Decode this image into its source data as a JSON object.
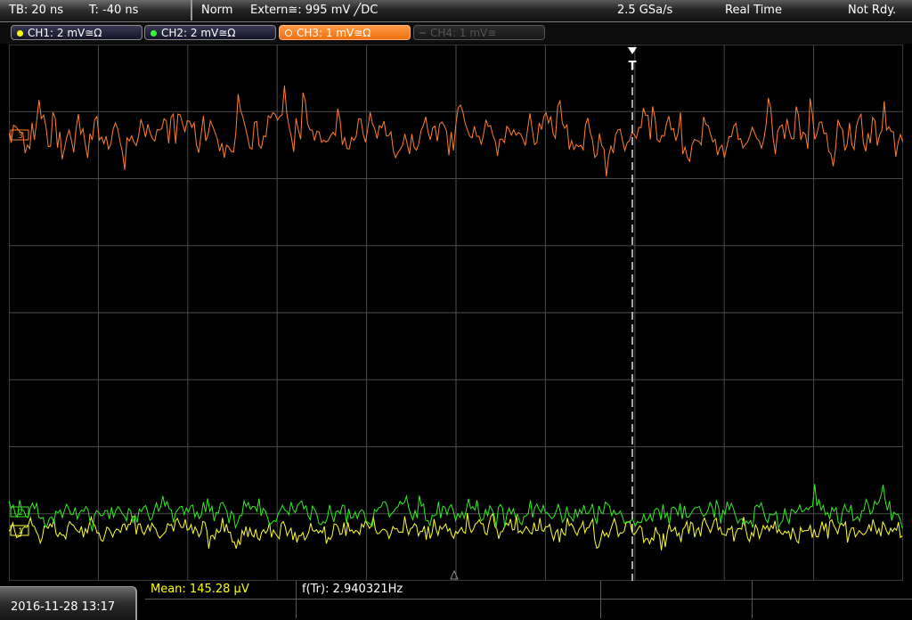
{
  "top_bar": {
    "timebase": "TB: 20 ns",
    "trigger_time": "T: -40 ns",
    "trigger_mode": "Norm",
    "trigger_source": "Extern≅: 995 mV ╱DC",
    "sample_rate": "2.5 GSa/s",
    "acq_mode": "Real Time",
    "status": "Not Rdy."
  },
  "channels": [
    {
      "label": "CH1: 2 mV≅Ω",
      "color": "#ffff00",
      "active": true
    },
    {
      "label": "CH2: 2 mV≅Ω",
      "color": "#33ff33",
      "active": true
    },
    {
      "label": "CH3: 1 mV≅Ω",
      "color": "#ff7f1a",
      "active": true,
      "selected": true
    },
    {
      "label": "CH4: 1 mV≅",
      "color": "#555555",
      "active": false
    }
  ],
  "markers": {
    "trigger_marker": "T",
    "ch3_marker": "3",
    "ch2_marker": "2",
    "ch1_marker": "1"
  },
  "bottom_bar": {
    "datetime": "2016-11-28 13:17",
    "measurements": [
      {
        "label": "Mean: 145.28 µV",
        "color": "#ffff00"
      },
      {
        "label": "f(Tr): 2.940321Hz",
        "color": "#ffffff"
      }
    ]
  },
  "colors": {
    "ch1_trace": "#ffff33",
    "ch2_trace": "#33ee22",
    "ch3_trace": "#ff8030",
    "grid": "#4a4a4a"
  }
}
